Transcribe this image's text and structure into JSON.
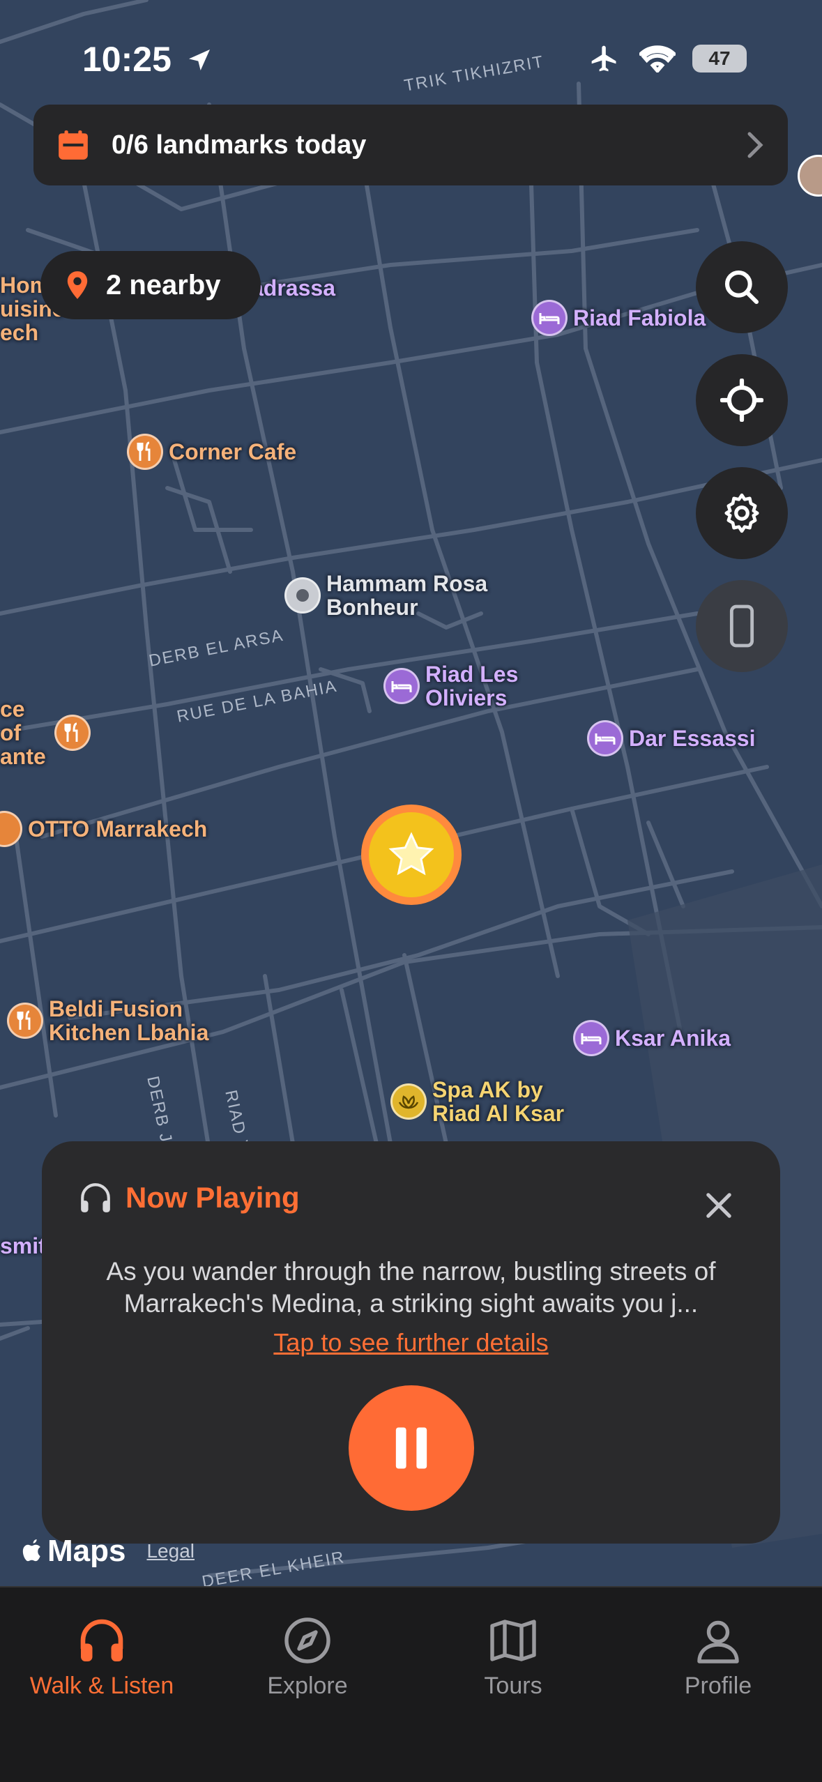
{
  "status_bar": {
    "time": "10:25",
    "battery": "47"
  },
  "landmarks_banner": {
    "text": "0/6 landmarks today"
  },
  "nearby": {
    "text": "2 nearby"
  },
  "map": {
    "streets": [
      {
        "name": "TRIK TIKHIZRIT"
      },
      {
        "name": "DERB EL ARSA"
      },
      {
        "name": "RUE DE LA BAHIA"
      },
      {
        "name": "DERB JA"
      },
      {
        "name": "RIAD Y"
      },
      {
        "name": "DEER EL KHEIR"
      }
    ],
    "pois": [
      {
        "name": "Riad Fabiola",
        "type": "hotel"
      },
      {
        "name": "Corner Cafe",
        "type": "food"
      },
      {
        "name": "Hammam Rosa Bonheur",
        "type": "gray"
      },
      {
        "name": "Riad Les Oliviers",
        "type": "hotel"
      },
      {
        "name": "Dar Essassi",
        "type": "hotel"
      },
      {
        "name": "OTTO Marrakech",
        "type": "food"
      },
      {
        "name": "Beldi Fusion Kitchen Lbahia",
        "type": "food"
      },
      {
        "name": "Ksar Anika",
        "type": "hotel"
      },
      {
        "name": "Spa AK by Riad Al Ksar",
        "type": "spa"
      },
      {
        "name": "adrassa",
        "type": "hotel"
      },
      {
        "name": "Home uisine ech",
        "type": "food"
      },
      {
        "name": "ce of ante",
        "type": "food"
      },
      {
        "name": "smit",
        "type": "hotel"
      }
    ],
    "attribution": {
      "brand": "Maps",
      "legal": "Legal"
    }
  },
  "now_playing": {
    "title": "Now Playing",
    "text": "As you wander through the narrow, bustling streets of Marrakech's Medina, a striking sight awaits you j...",
    "link": "Tap to see further details"
  },
  "tabs": [
    {
      "label": "Walk & Listen",
      "icon": "headphones-icon",
      "active": true
    },
    {
      "label": "Explore",
      "icon": "compass-icon",
      "active": false
    },
    {
      "label": "Tours",
      "icon": "map-icon",
      "active": false
    },
    {
      "label": "Profile",
      "icon": "person-icon",
      "active": false
    }
  ],
  "colors": {
    "accent": "#ff6b35",
    "hotel": "#9b6ad6",
    "food": "#e6853a",
    "spa": "#e0b52c"
  }
}
